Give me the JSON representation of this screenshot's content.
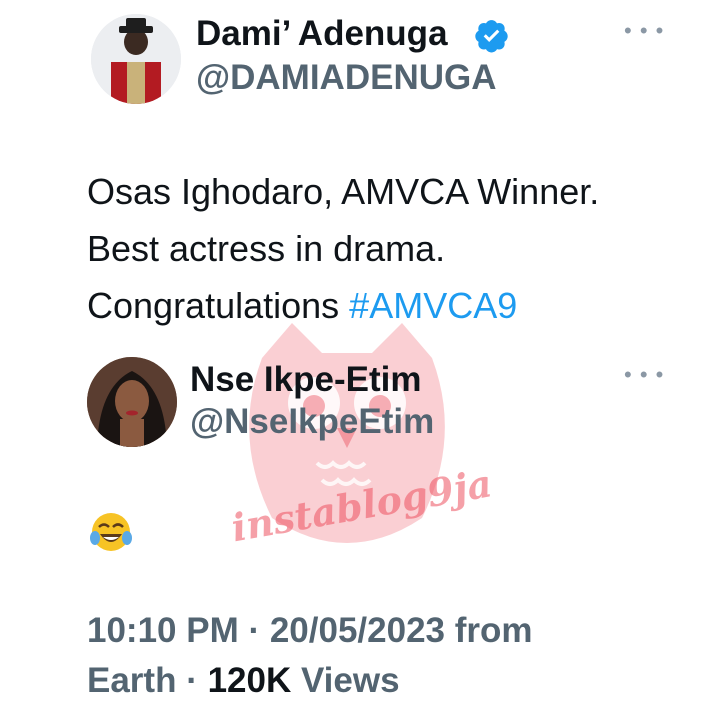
{
  "tweet": {
    "author": {
      "name": "Dami’ Adenuga",
      "handle": "@DAMIADENUGA",
      "verified": true,
      "avatar": "avatar-photo-man-red-jacket"
    },
    "text_lines": [
      "Osas Ighodaro, AMVCA Winner.",
      "Best actress in drama.",
      "Congratulations "
    ],
    "hashtag": "#AMVCA9",
    "more_icon": "more-dots-icon"
  },
  "reply": {
    "author": {
      "name": "Nse Ikpe-Etim",
      "handle": "@NseIkpeEtim",
      "avatar": "avatar-photo-woman"
    },
    "emoji": "tears-of-joy-emoji",
    "more_icon": "more-dots-icon"
  },
  "meta": {
    "line1": "10:10 PM · 20/05/2023 from",
    "line2_prefix": "Earth · ",
    "views_count": "120K",
    "views_label": " Views"
  },
  "watermark": {
    "text": "instablog9ja",
    "icon": "owl-logo-icon"
  },
  "colors": {
    "text": "#0f1419",
    "secondary": "#536471",
    "link": "#1d9bf0",
    "verified": "#1d9bf0",
    "watermark": "#ec5260"
  }
}
